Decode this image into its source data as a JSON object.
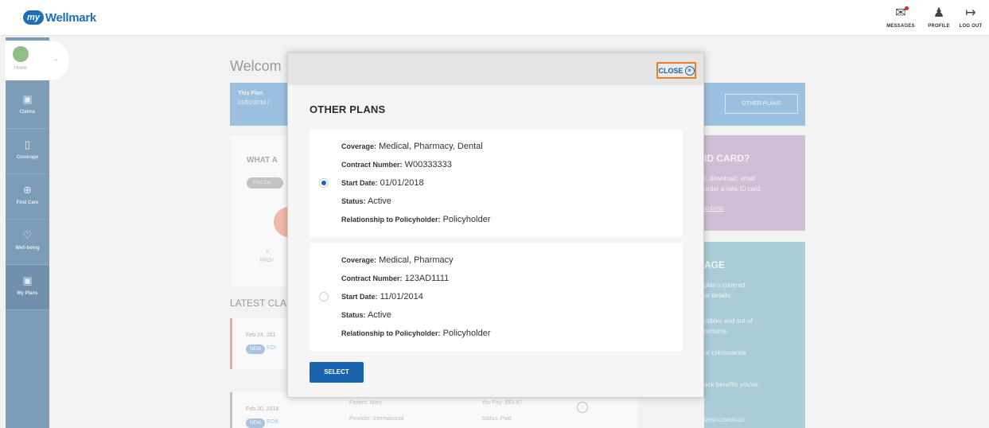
{
  "header": {
    "logo_bubble": "my",
    "logo_text": "Wellmark",
    "messages_label": "MESSAGES",
    "profile_label": "PROFILE",
    "logout_label": "LOG OUT"
  },
  "sidenav": {
    "home_label": "Home",
    "items": [
      {
        "label": "Claims",
        "icon": "claims-icon"
      },
      {
        "label": "Coverage",
        "icon": "coverage-icon"
      },
      {
        "label": "Find Care",
        "icon": "find-care-icon"
      },
      {
        "label": "Well-being",
        "icon": "heart-icon"
      },
      {
        "label": "My Plans",
        "icon": "my-plans-icon"
      }
    ]
  },
  "background": {
    "welcome": "Welcom",
    "plan_bar": {
      "title": "This Plan",
      "dates": "01/01/2018 /",
      "other_plans": "OTHER PLANS"
    },
    "what_card": {
      "heading": "WHAT A",
      "pill": "Find Car",
      "prov1": "F",
      "prov2": "PROV"
    },
    "latest_claims": "LATEST CLA",
    "claims": [
      {
        "date": "Feb 24, 201",
        "badge": "NEW",
        "doc": "EOI"
      },
      {
        "date": "Feb 20, 2018",
        "badge": "NEW",
        "doc": "EOB"
      }
    ],
    "claim_row": {
      "patient": "Patient: Mary",
      "provider": "Provider: International",
      "you_pay": "You Pay: $93.97",
      "status": "Status: Paid"
    },
    "id_card": {
      "heading": "ID CARD?",
      "line1": "t, download, email",
      "line2": "order a new ID card.",
      "link": "ID CARD"
    },
    "coverage": {
      "heading": "AGE",
      "line1": "plan's covered",
      "line2": "er details:",
      "line3": "ctibles and out-of",
      "line4": "nimums.",
      "line5": "or coinsurance",
      "line6": "ack benefits you've",
      "link": "VIEW COVERAGE"
    }
  },
  "modal": {
    "close_label": "CLOSE",
    "title": "OTHER PLANS",
    "select_label": "SELECT",
    "plans": [
      {
        "selected": true,
        "coverage_key": "Coverage:",
        "coverage": "Medical, Pharmacy, Dental",
        "contract_key": "Contract Number:",
        "contract": "W00333333",
        "start_key": "Start Date:",
        "start": "01/01/2018",
        "status_key": "Status:",
        "status": "Active",
        "rel_key": "Relationship to Policyholder:",
        "rel": "Policyholder"
      },
      {
        "selected": false,
        "coverage_key": "Coverage:",
        "coverage": "Medical, Pharmacy",
        "contract_key": "Contract Number:",
        "contract": "123AD1111",
        "start_key": "Start Date:",
        "start": "11/01/2014",
        "status_key": "Status:",
        "status": "Active",
        "rel_key": "Relationship to Policyholder:",
        "rel": "Policyholder"
      }
    ]
  },
  "colors": {
    "brand_blue": "#1a64ad",
    "close_outline": "#f07d24",
    "sidenav": "#7c9cb8"
  }
}
